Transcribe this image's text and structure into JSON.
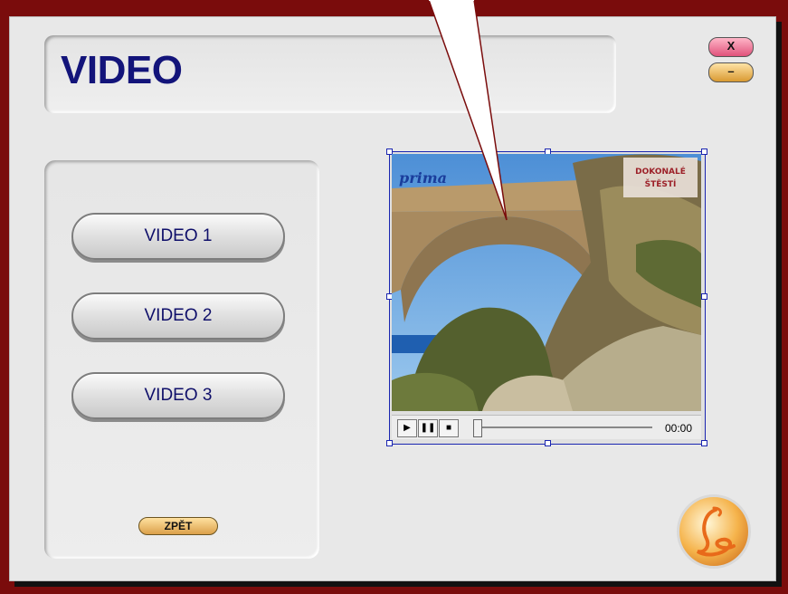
{
  "header": {
    "title": "VIDEO"
  },
  "window_controls": {
    "close_label": "X",
    "minimize_label": "–"
  },
  "menu": {
    "items": [
      {
        "label": "VIDEO 1"
      },
      {
        "label": "VIDEO 2"
      },
      {
        "label": "VIDEO 3"
      }
    ],
    "back_label": "ZPĚT"
  },
  "video": {
    "channel_logo": "prima",
    "overlay_text_line1": "DOKONALÉ",
    "overlay_text_line2": "ŠTĚSTÍ",
    "time": "00:00",
    "progress": 0,
    "icons": {
      "play": "play-icon",
      "pause": "pause-icon",
      "stop": "stop-icon"
    }
  },
  "colors": {
    "background": "#7a0c0c",
    "panel": "#e8e8e8",
    "title": "#13147a",
    "close_button": "#e0527a",
    "minimize_button": "#d99a32",
    "selection": "#1a25b0"
  }
}
